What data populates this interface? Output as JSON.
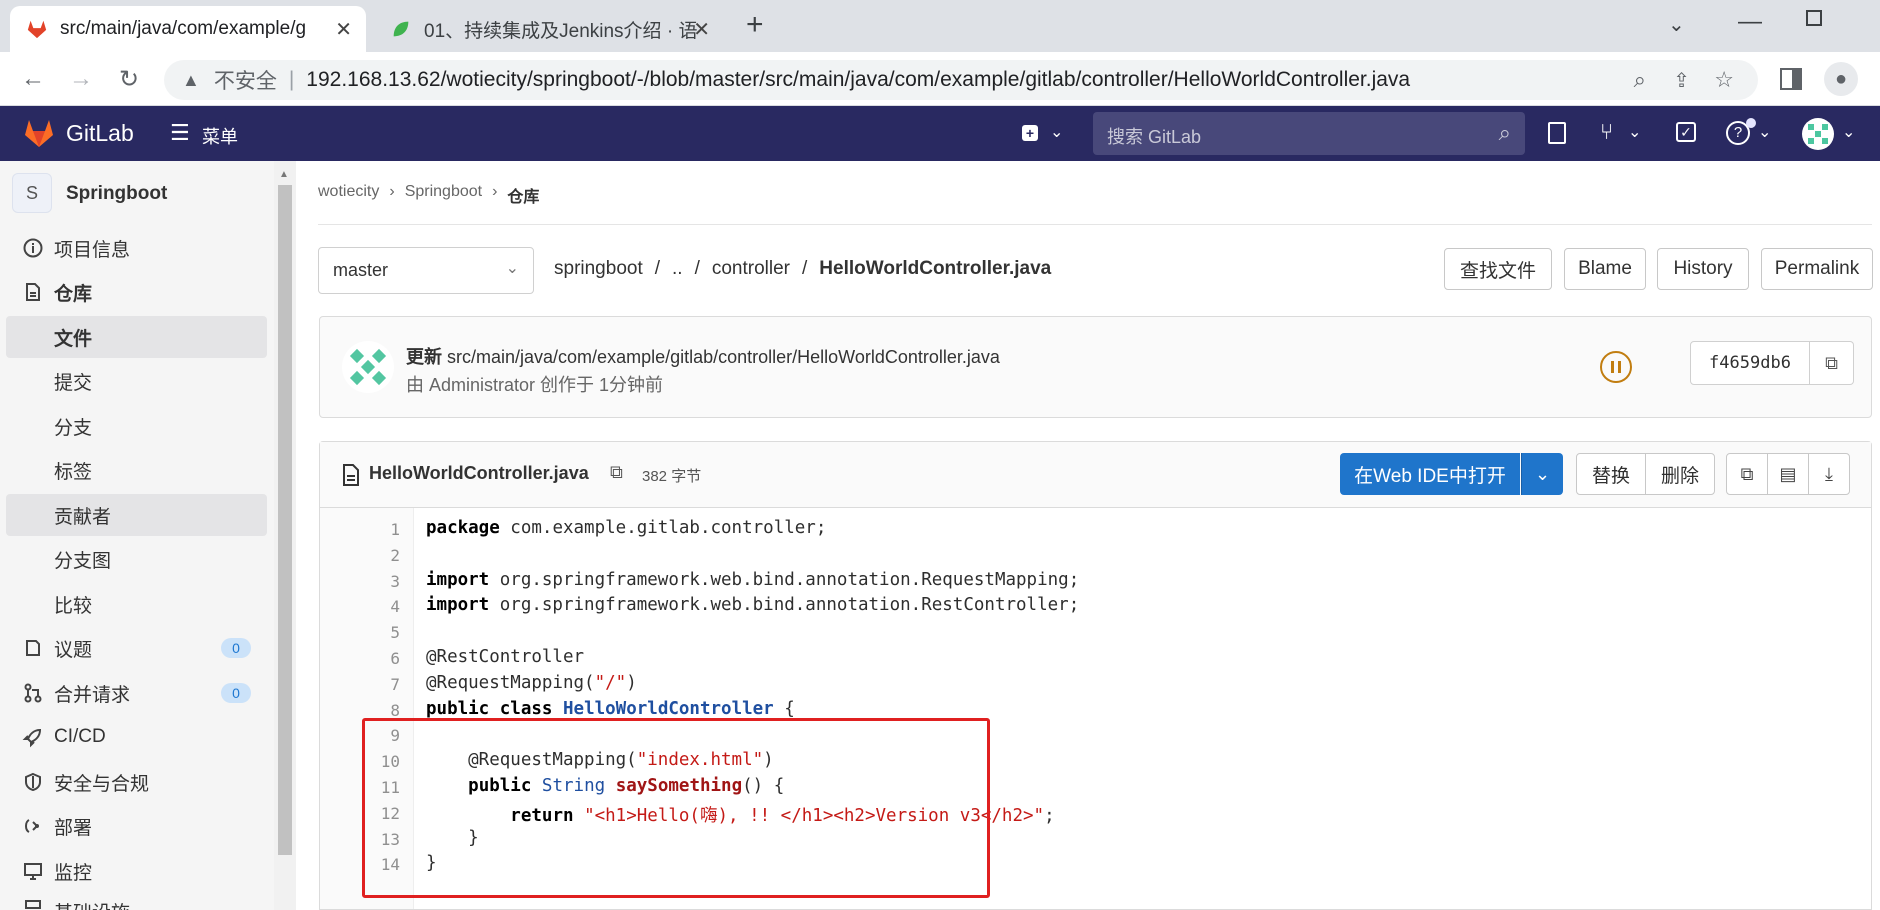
{
  "browser": {
    "tabs": [
      {
        "title": "src/main/java/com/example/g",
        "active": true
      },
      {
        "title": "01、持续集成及Jenkins介绍 · 语",
        "active": false
      }
    ],
    "new_tab": "+",
    "security_label": "不安全",
    "url": "192.168.13.62/wotiecity/springboot/-/blob/master/src/main/java/com/example/gitlab/controller/HelloWorldController.java"
  },
  "gitlab_header": {
    "brand": "GitLab",
    "menu_label": "菜单",
    "search_placeholder": "搜索 GitLab"
  },
  "sidebar": {
    "project_initial": "S",
    "project_name": "Springboot",
    "items": [
      {
        "label": "项目信息",
        "icon": "info-icon"
      },
      {
        "label": "仓库",
        "icon": "document-icon"
      },
      {
        "label": "文件"
      },
      {
        "label": "提交"
      },
      {
        "label": "分支"
      },
      {
        "label": "标签"
      },
      {
        "label": "贡献者"
      },
      {
        "label": "分支图"
      },
      {
        "label": "比较"
      },
      {
        "label": "议题",
        "icon": "issues-icon",
        "count": "0"
      },
      {
        "label": "合并请求",
        "icon": "merge-icon",
        "count": "0"
      },
      {
        "label": "CI/CD",
        "icon": "rocket-icon"
      },
      {
        "label": "安全与合规",
        "icon": "shield-icon"
      },
      {
        "label": "部署",
        "icon": "deploy-icon"
      },
      {
        "label": "监控",
        "icon": "monitor-icon"
      },
      {
        "label": "基础设施",
        "icon": "infra-icon"
      }
    ]
  },
  "breadcrumb": {
    "items": [
      "wotiecity",
      "Springboot",
      "仓库"
    ]
  },
  "file_nav": {
    "branch": "master",
    "path": [
      "springboot",
      "..",
      "controller"
    ],
    "filename": "HelloWorldController.java",
    "buttons": {
      "find": "查找文件",
      "blame": "Blame",
      "history": "History",
      "permalink": "Permalink"
    }
  },
  "commit": {
    "action": "更新",
    "path": "src/main/java/com/example/gitlab/controller/HelloWorldController.java",
    "meta": "由 Administrator 创作于 1分钟前",
    "sha": "f4659db6"
  },
  "file_header": {
    "name": "HelloWorldController.java",
    "size": "382 字节",
    "open_ide": "在Web IDE中打开",
    "replace": "替换",
    "delete": "删除"
  },
  "code_lines": [
    "package com.example.gitlab.controller;",
    "",
    "import org.springframework.web.bind.annotation.RequestMapping;",
    "import org.springframework.web.bind.annotation.RestController;",
    "",
    "@RestController",
    "@RequestMapping(\"/\")",
    "public class HelloWorldController {",
    "",
    "    @RequestMapping(\"index.html\")",
    "    public String saySomething() {",
    "        return \"<h1>Hello(嗨), !! </h1><h2>Version v3</h2>\";",
    "    }",
    "}"
  ],
  "colors": {
    "gitlab_header": "#292961",
    "primary_button": "#1f75cb",
    "highlight_box": "#e02020",
    "pipeline_status": "#c17d10"
  }
}
